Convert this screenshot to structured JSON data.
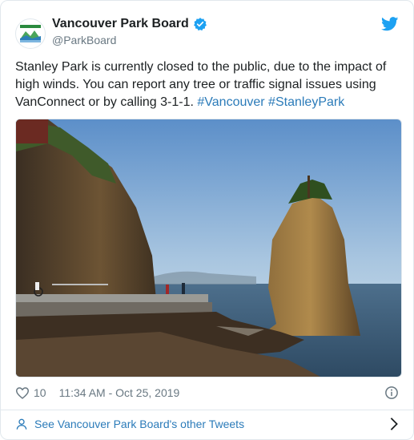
{
  "account": {
    "display_name": "Vancouver Park Board",
    "handle": "@ParkBoard",
    "verified": true,
    "avatar_icon": "park-board-logo"
  },
  "tweet": {
    "text_plain": "Stanley Park is currently closed to the public, due to the impact of high winds. You can report any tree or traffic signal issues using VanConnect or by calling 3-1-1. ",
    "hashtag_1": "#Vancouver",
    "hashtag_2": "#StanleyPark"
  },
  "media": {
    "icon": "photo-siwash-rock"
  },
  "meta": {
    "like_count": "10",
    "timestamp": "11:34 AM - Oct 25, 2019"
  },
  "footer": {
    "link_text": "See Vancouver Park Board's other Tweets"
  },
  "colors": {
    "link": "#2b7bb9",
    "muted": "#697882",
    "twitter_blue": "#1da1f2",
    "border": "#e1e8ed"
  }
}
